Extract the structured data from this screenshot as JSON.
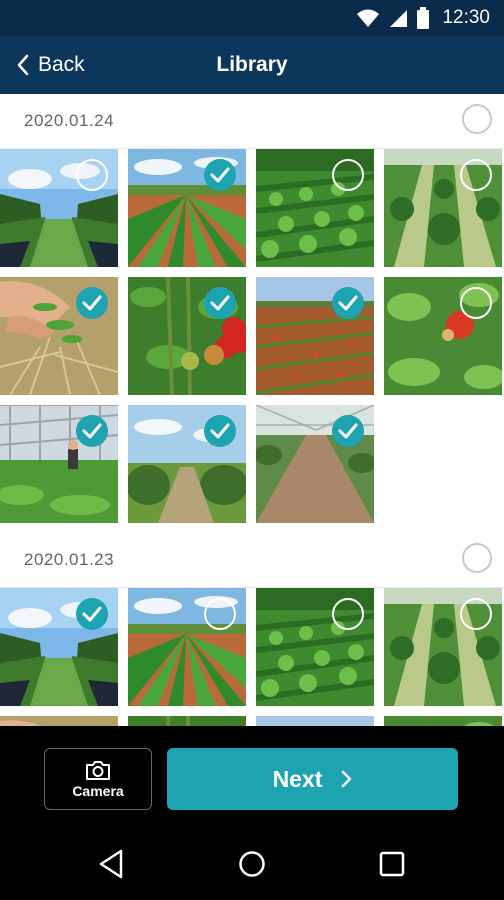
{
  "status_bar": {
    "time": "12:30",
    "icons": [
      "wifi-icon",
      "signal-icon",
      "battery-icon"
    ]
  },
  "header": {
    "back_label": "Back",
    "title": "Library"
  },
  "groups": [
    {
      "date": "2020.01.24",
      "photos": [
        {
          "scene": "raised-rows",
          "selected": false
        },
        {
          "scene": "lettuce-field",
          "selected": true
        },
        {
          "scene": "green-field",
          "selected": false
        },
        {
          "scene": "strawberry-rows",
          "selected": false
        },
        {
          "scene": "hand-weeds",
          "selected": true
        },
        {
          "scene": "tomato-plants",
          "selected": true
        },
        {
          "scene": "red-field",
          "selected": true
        },
        {
          "scene": "tomato-close",
          "selected": false
        },
        {
          "scene": "greenhouse",
          "selected": true
        },
        {
          "scene": "path-field",
          "selected": true
        },
        {
          "scene": "dirt-path",
          "selected": true
        }
      ]
    },
    {
      "date": "2020.01.23",
      "photos": [
        {
          "scene": "raised-rows",
          "selected": true
        },
        {
          "scene": "lettuce-field",
          "selected": false
        },
        {
          "scene": "green-field",
          "selected": false
        },
        {
          "scene": "strawberry-rows",
          "selected": false
        },
        {
          "scene": "hand-weeds",
          "selected": true
        },
        {
          "scene": "tomato-plants",
          "selected": true
        },
        {
          "scene": "red-field",
          "selected": true
        },
        {
          "scene": "tomato-close",
          "selected": false
        }
      ]
    }
  ],
  "actions": {
    "camera_label": "Camera",
    "next_label": "Next"
  },
  "colors": {
    "status_bar": "#0a2a4a",
    "app_bar": "#0c365c",
    "accent": "#1ea3b1"
  }
}
